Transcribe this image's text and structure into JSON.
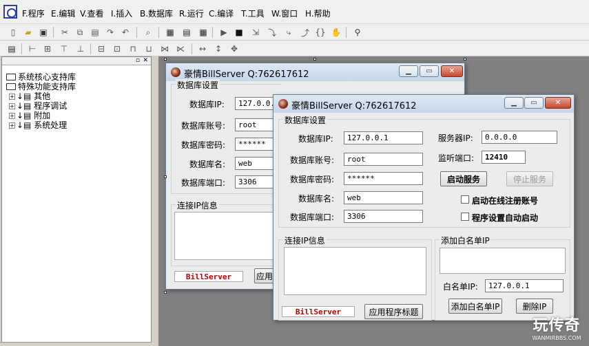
{
  "menu": [
    "F.程序",
    "E.编辑",
    "V.查看",
    "I.插入",
    "B.数据库",
    "R.运行",
    "C.编译",
    "T.工具",
    "W.窗口",
    "H.帮助"
  ],
  "tree": {
    "items": [
      {
        "label": "系统核心支持库",
        "expand": ""
      },
      {
        "label": "特殊功能支持库",
        "expand": ""
      },
      {
        "label": "其他",
        "expand": "+"
      },
      {
        "label": "程序调试",
        "expand": "+"
      },
      {
        "label": "附加",
        "expand": "+"
      },
      {
        "label": "系统处理",
        "expand": "+"
      }
    ]
  },
  "back_window": {
    "title": "豪情BillServer Q:762617612",
    "group_db": "数据库设置",
    "labels": {
      "ip": "数据库IP:",
      "account": "数据库账号:",
      "password": "数据库密码:",
      "name": "数据库名:",
      "port": "数据库端口:"
    },
    "values": {
      "ip": "127.0.0.",
      "account": "root",
      "password": "******",
      "name": "web",
      "port": "3306"
    },
    "group_conn": "连接IP信息",
    "brand": "BillServer",
    "app_title_btn": "应用"
  },
  "front_window": {
    "title": "豪情BillServer Q:762617612",
    "group_db": "数据库设置",
    "labels": {
      "ip": "数据库IP:",
      "account": "数据库账号:",
      "password": "数据库密码:",
      "name": "数据库名:",
      "port": "数据库端口:"
    },
    "values": {
      "ip": "127.0.0.1",
      "account": "root",
      "password": "******",
      "name": "web",
      "port": "3306"
    },
    "server_ip_label": "服务器IP:",
    "server_ip_value": "0.0.0.0",
    "listen_port_label": "监听端口:",
    "listen_port_value": "12410",
    "start_btn": "启动服务",
    "stop_btn": "停止服务",
    "chk_online": "启动在线注册账号",
    "chk_autostart": "程序设置自动启动",
    "group_conn": "连接IP信息",
    "group_white": "添加白名单IP",
    "white_ip_label": "白名单IP:",
    "white_ip_value": "127.0.0.1",
    "add_white_btn": "添加白名单IP",
    "del_ip_btn": "删除IP",
    "brand": "BillServer",
    "app_title_btn": "应用程序标题"
  },
  "watermark": {
    "main": "玩传奇",
    "sub": "WANMIRBBS.COM"
  }
}
